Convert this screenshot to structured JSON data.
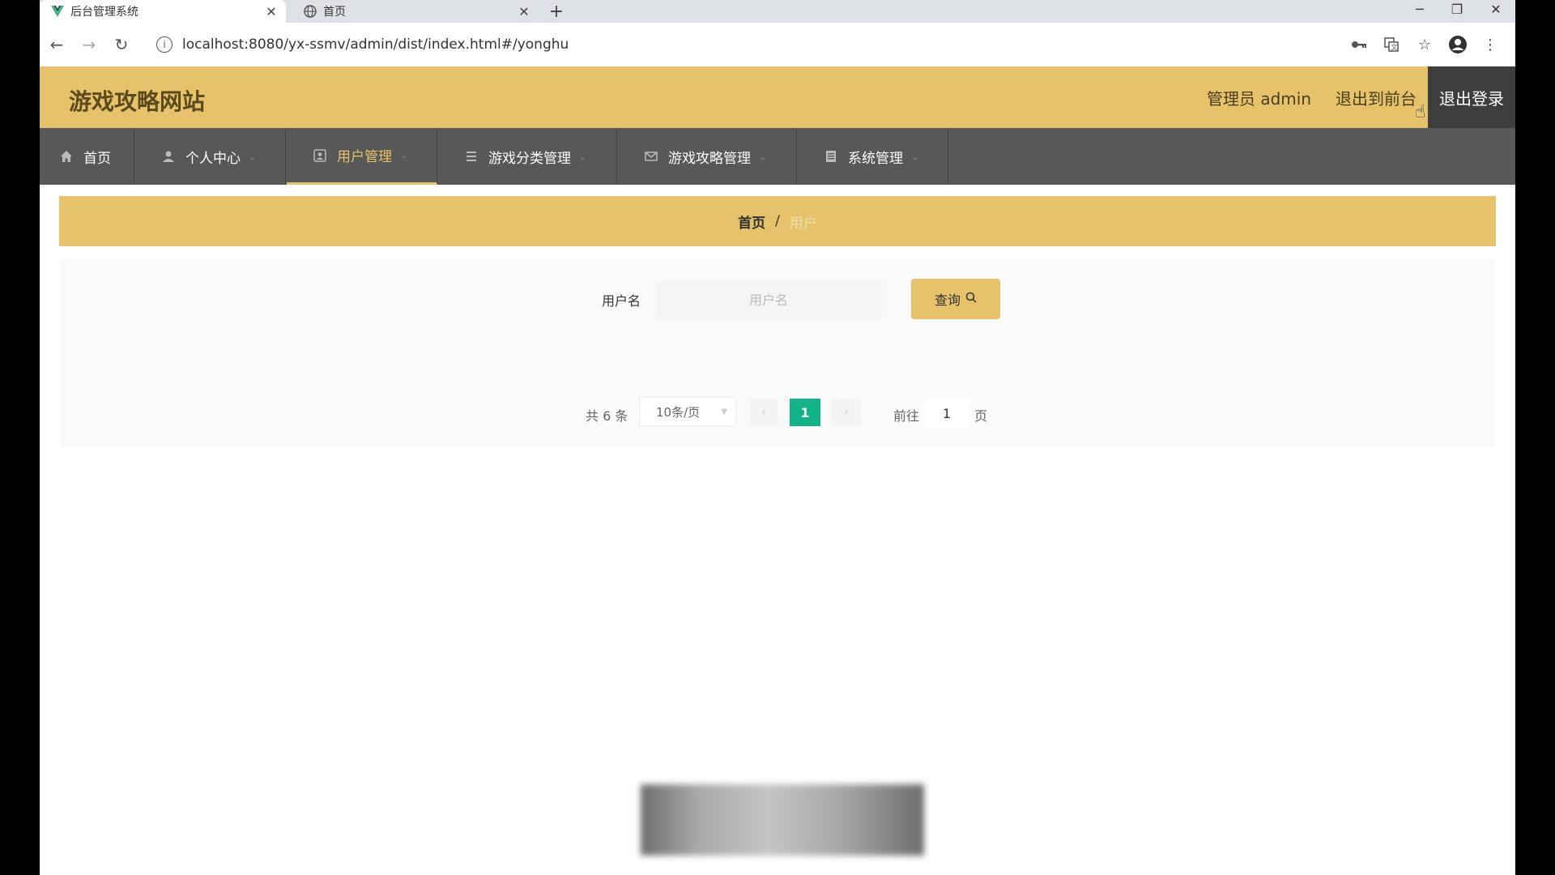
{
  "browser": {
    "tabs": [
      {
        "title": "后台管理系统",
        "close": "✕",
        "favicon": "vue-logo-icon"
      },
      {
        "title": "首页",
        "close": "✕",
        "favicon": "globe-icon"
      }
    ],
    "new_tab": "+",
    "url": "localhost:8080/yx-ssmv/admin/dist/index.html#/yonghu"
  },
  "header": {
    "site_title": "游戏攻略网站",
    "admin_label": "管理员 admin",
    "back_to_front": "退出到前台",
    "logout": "退出登录"
  },
  "nav": {
    "items": [
      {
        "label": "首页",
        "icon": "home-icon"
      },
      {
        "label": "个人中心",
        "icon": "user-icon"
      },
      {
        "label": "用户管理",
        "icon": "user-manage-icon",
        "active": true
      },
      {
        "label": "游戏分类管理",
        "icon": "list-icon"
      },
      {
        "label": "游戏攻略管理",
        "icon": "mail-icon"
      },
      {
        "label": "系统管理",
        "icon": "document-icon"
      }
    ]
  },
  "breadcrumb": {
    "home": "首页",
    "separator": "/",
    "current": "用户"
  },
  "search": {
    "label": "用户名",
    "placeholder": "用户名",
    "button": "查询"
  },
  "pagination": {
    "total": "共 6 条",
    "page_size": "10条/页",
    "prev": "‹",
    "current_page": "1",
    "next": "›",
    "goto_label": "前往",
    "goto_value": "1",
    "page_suffix": "页"
  },
  "colors": {
    "accent": "#e6c36a",
    "nav_bg": "#585858",
    "pager_active": "#13b38a"
  }
}
